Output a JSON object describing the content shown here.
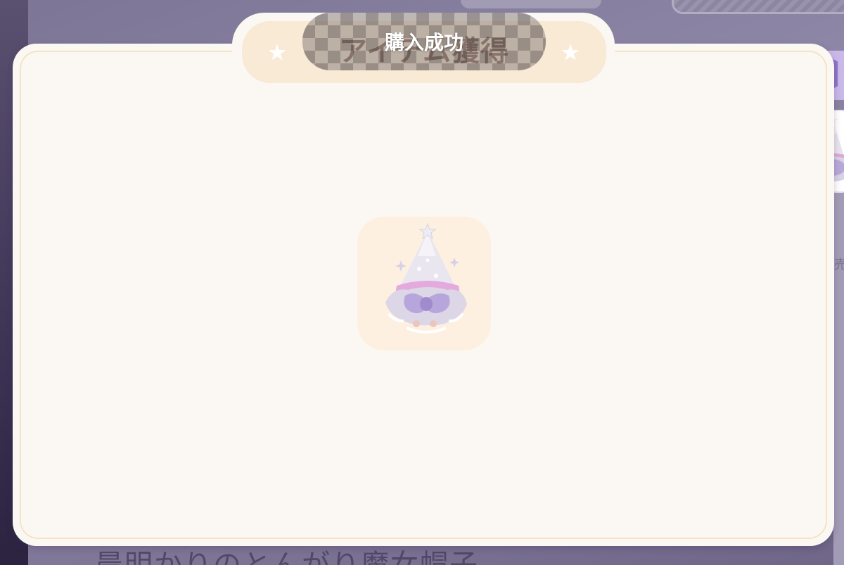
{
  "toast": {
    "text": "購入成功"
  },
  "dialog": {
    "title": "アイテム獲得"
  },
  "item": {
    "icon": "witch-hat-icon"
  },
  "side_panel": {
    "category_icon": "shirt-icon",
    "gift_icon": "gift-icon"
  },
  "background": {
    "item_name_partial": "晨明かりのとんがり魔女帽子",
    "right_edge_text": "売"
  },
  "colors": {
    "modal_bg": "#fbf8f3",
    "title_plate": "#f8ead5",
    "title_text": "#8c6f5c",
    "gift_button": "#f06a82",
    "category_hex": "#8f74c9"
  }
}
